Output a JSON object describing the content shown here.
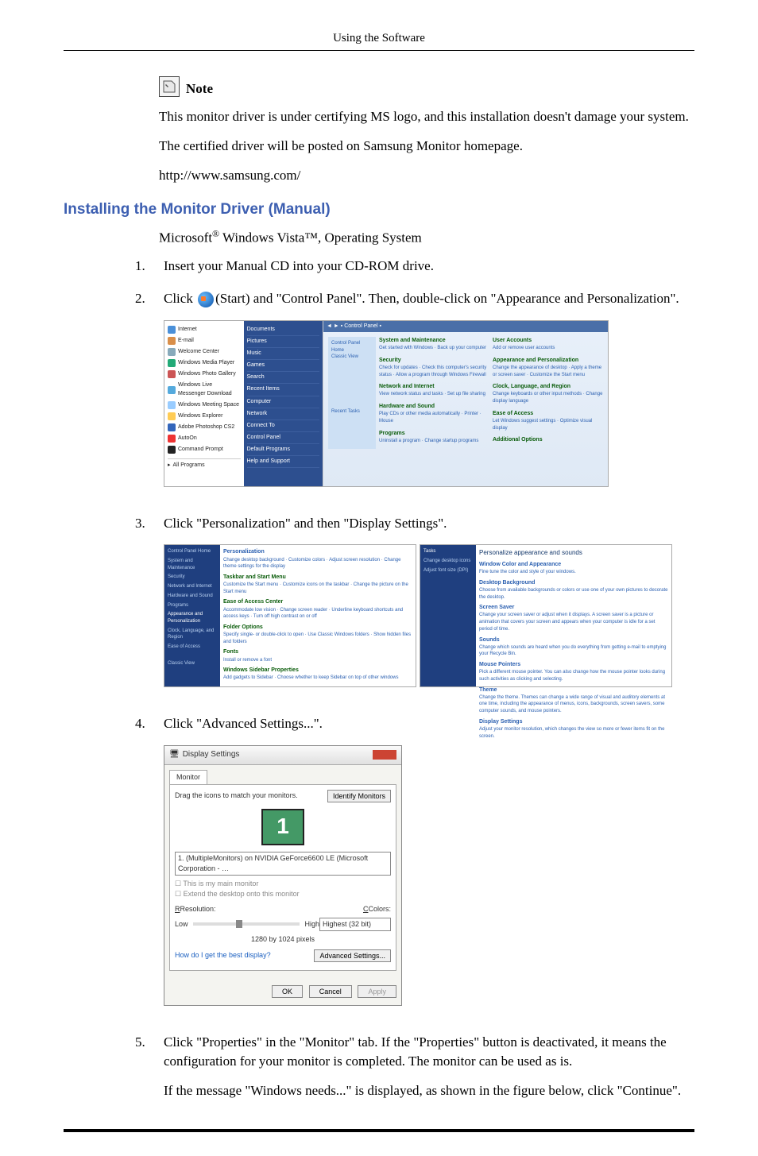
{
  "header": {
    "title": "Using the Software"
  },
  "note": {
    "label": "Note",
    "line1": "This monitor driver is under certifying MS logo, and this installation doesn't damage your system.",
    "line2": "The certified driver will be posted on Samsung Monitor homepage.",
    "url": "http://www.samsung.com/"
  },
  "section": {
    "heading": "Installing the Monitor Driver (Manual)",
    "os_prefix": "Microsoft",
    "os_suffix": " Windows Vista™, Operating System"
  },
  "steps": {
    "s1_num": "1.",
    "s1_text": "Insert your Manual CD into your CD-ROM drive.",
    "s2_num": "2.",
    "s2_a": "Click ",
    "s2_b": "(Start) and \"Control Panel\". Then, double-click on \"Appearance and Personalization\".",
    "s3_num": "3.",
    "s3_text": "Click \"Personalization\" and then \"Display Settings\".",
    "s4_num": "4.",
    "s4_text": "Click \"Advanced Settings...\".",
    "s5_num": "5.",
    "s5_p1": "Click \"Properties\" in the \"Monitor\" tab. If the \"Properties\" button is deactivated, it means the configuration for your monitor is completed. The monitor can be used as is.",
    "s5_p2": "If the message \"Windows needs...\" is displayed, as shown in the figure below, click \"Continue\"."
  },
  "fig1": {
    "start_items": [
      "Internet",
      "E-mail",
      "Welcome Center",
      "Windows Media Player",
      "Windows Photo Gallery",
      "Windows Live Messenger Download",
      "Windows Meeting Space",
      "Windows Explorer",
      "Adobe Photoshop CS2",
      "AutoOn",
      "Command Prompt"
    ],
    "all_programs": "All Programs",
    "right_items": [
      "Documents",
      "Pictures",
      "Music",
      "Games",
      "Search",
      "Recent Items",
      "Computer",
      "Network",
      "Connect To",
      "Control Panel",
      "Default Programs",
      "Help and Support"
    ],
    "addr": "Control Panel",
    "sidebar": [
      "Control Panel Home",
      "Classic View"
    ],
    "sidebar2": [
      "Recent Tasks"
    ],
    "cats": [
      {
        "t": "System and Maintenance",
        "s": "Get started with Windows · Back up your computer"
      },
      {
        "t": "Security",
        "s": "Check for updates · Check this computer's security status · Allow a program through Windows Firewall"
      },
      {
        "t": "Network and Internet",
        "s": "View network status and tasks · Set up file sharing"
      },
      {
        "t": "Hardware and Sound",
        "s": "Play CDs or other media automatically · Printer · Mouse"
      },
      {
        "t": "Programs",
        "s": "Uninstall a program · Change startup programs"
      }
    ],
    "cats2": [
      {
        "t": "User Accounts",
        "s": "Add or remove user accounts"
      },
      {
        "t": "Appearance and Personalization",
        "s": "Change the appearance of desktop · Apply a theme or screen saver · Customize the Start menu"
      },
      {
        "t": "Clock, Language, and Region",
        "s": "Change keyboards or other input methods · Change display language"
      },
      {
        "t": "Ease of Access",
        "s": "Let Windows suggest settings · Optimize visual display"
      },
      {
        "t": "Additional Options",
        "s": ""
      }
    ]
  },
  "fig2": {
    "left_side": [
      "Control Panel Home",
      "System and Maintenance",
      "Security",
      "Network and Internet",
      "Hardware and Sound",
      "Programs",
      "Appearance and Personalization",
      "Clock, Language, and Region",
      "Ease of Access",
      "",
      "Classic View"
    ],
    "left_items": [
      {
        "h": "Personalization",
        "t": "Change desktop background · Customize colors · Adjust screen resolution · Change theme settings for the display"
      },
      {
        "h": "Taskbar and Start Menu",
        "t": "Customize the Start menu · Customize icons on the taskbar · Change the picture on the Start menu"
      },
      {
        "h": "Ease of Access Center",
        "t": "Accommodate low vision · Change screen reader · Underline keyboard shortcuts and access keys · Turn off high contrast on or off"
      },
      {
        "h": "Folder Options",
        "t": "Specify single- or double-click to open · Use Classic Windows folders · Show hidden files and folders"
      },
      {
        "h": "Fonts",
        "t": "Install or remove a font"
      },
      {
        "h": "Windows Sidebar Properties",
        "t": "Add gadgets to Sidebar · Choose whether to keep Sidebar on top of other windows"
      }
    ],
    "right_side": [
      "Tasks",
      "Change desktop icons",
      "Adjust font size (DPI)"
    ],
    "right_head": "Personalize appearance and sounds",
    "right_items": [
      {
        "h": "Window Color and Appearance",
        "t": "Fine tune the color and style of your windows."
      },
      {
        "h": "Desktop Background",
        "t": "Choose from available backgrounds or colors or use one of your own pictures to decorate the desktop."
      },
      {
        "h": "Screen Saver",
        "t": "Change your screen saver or adjust when it displays. A screen saver is a picture or animation that covers your screen and appears when your computer is idle for a set period of time."
      },
      {
        "h": "Sounds",
        "t": "Change which sounds are heard when you do everything from getting e-mail to emptying your Recycle Bin."
      },
      {
        "h": "Mouse Pointers",
        "t": "Pick a different mouse pointer. You can also change how the mouse pointer looks during such activities as clicking and selecting."
      },
      {
        "h": "Theme",
        "t": "Change the theme. Themes can change a wide range of visual and auditory elements at one time, including the appearance of menus, icons, backgrounds, screen savers, some computer sounds, and mouse pointers."
      },
      {
        "h": "Display Settings",
        "t": "Adjust your monitor resolution, which changes the view so more or fewer items fit on the screen."
      }
    ]
  },
  "fig3": {
    "title": "Display Settings",
    "tab": "Monitor",
    "drag": "Drag the icons to match your monitors.",
    "identify": "Identify Monitors",
    "mon_num": "1",
    "monitor_dd": "1. (MultipleMonitors) on NVIDIA GeForce6600 LE (Microsoft Corporation - …",
    "chk1": "This is my main monitor",
    "chk2": "Extend the desktop onto this monitor",
    "res_label": "Resolution:",
    "col_label": "Colors:",
    "low": "Low",
    "high": "High",
    "res_value": "1280 by 1024 pixels",
    "color_value": "Highest (32 bit)",
    "help": "How do I get the best display?",
    "adv": "Advanced Settings...",
    "ok": "OK",
    "cancel": "Cancel",
    "apply": "Apply"
  }
}
